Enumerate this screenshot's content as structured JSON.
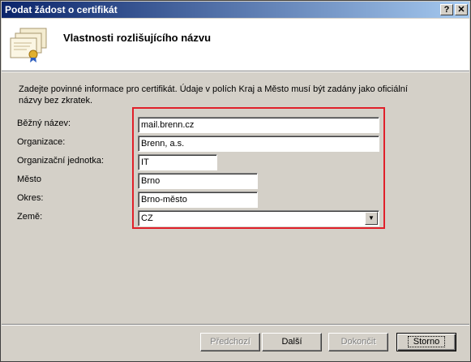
{
  "window": {
    "title": "Podat žádost o certifikát",
    "help_label": "?",
    "close_label": "✕"
  },
  "header": {
    "title": "Vlastnosti rozlišujícího názvu"
  },
  "instructions": "Zadejte povinné informace pro certifikát. Údaje v polích Kraj a Město musí být zadány jako oficiální názvy bez zkratek.",
  "form": {
    "common_name": {
      "label": "Běžný název:",
      "value": "mail.brenn.cz"
    },
    "organization": {
      "label": "Organizace:",
      "value": "Brenn, a.s."
    },
    "org_unit": {
      "label": "Organizační jednotka:",
      "value": "IT"
    },
    "city": {
      "label": "Město",
      "value": "Brno"
    },
    "district": {
      "label": "Okres:",
      "value": "Brno-město"
    },
    "country": {
      "label": "Země:",
      "value": "CZ"
    }
  },
  "buttons": {
    "back": "Předchozí",
    "next": "Další",
    "finish": "Dokončit",
    "cancel": "Storno"
  }
}
